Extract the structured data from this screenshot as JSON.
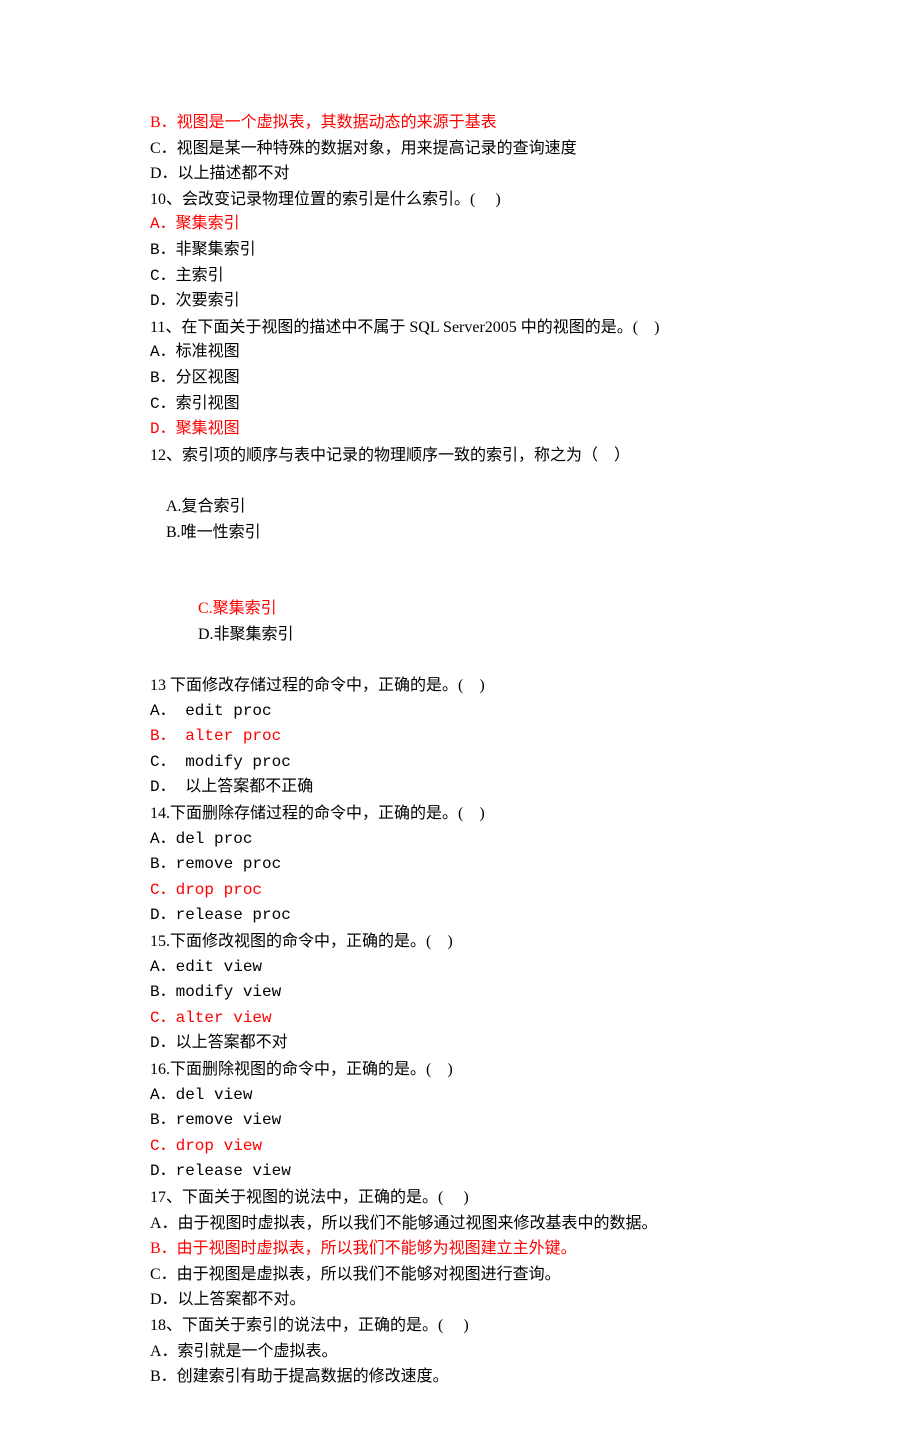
{
  "lines": {
    "l01": "B．视图是一个虚拟表，其数据动态的来源于基表",
    "l02": "C．视图是某一种特殊的数据对象，用来提高记录的查询速度",
    "l03": "D．以上描述都不对",
    "l04": "10、会改变记录物理位置的索引是什么索引。(     )",
    "l05": "A．聚集索引",
    "l06": "B．非聚集索引",
    "l07": "C．主索引",
    "l08": "D．次要索引",
    "l09": "11、在下面关于视图的描述中不属于 SQL Server2005 中的视图的是。(    )",
    "l10": "A．标准视图",
    "l11": "B．分区视图",
    "l12": "C．索引视图",
    "l13": "D．聚集视图",
    "l14": "12、索引项的顺序与表中记录的物理顺序一致的索引，称之为（    ）",
    "l15a": "A.复合索引",
    "l15b": "B.唯一性索引",
    "l16a": "C.聚集索引",
    "l16b": "D.非聚集索引",
    "l17": "13 下面修改存储过程的命令中，正确的是。(    )",
    "l18": "A． edit proc",
    "l19": "B． alter proc",
    "l20": "C． modify proc",
    "l21": "D． 以上答案都不正确",
    "l22": "14.下面删除存储过程的命令中，正确的是。(    )",
    "l23": "A．del proc",
    "l24": "B．remove proc",
    "l25": "C．drop proc",
    "l26": "D．release proc",
    "l27": "15.下面修改视图的命令中，正确的是。(    )",
    "l28": "A．edit view",
    "l29": "B．modify view",
    "l30": "C．alter view",
    "l31": "D．以上答案都不对",
    "l32": "16.下面删除视图的命令中，正确的是。(    )",
    "l33": "A．del view",
    "l34": "B．remove view",
    "l35": "C．drop view",
    "l36": "D．release view",
    "l37": "17、下面关于视图的说法中，正确的是。(     )",
    "l38": "A．由于视图时虚拟表，所以我们不能够通过视图来修改基表中的数据。",
    "l39": "B．由于视图时虚拟表，所以我们不能够为视图建立主外键。",
    "l40": "C．由于视图是虚拟表，所以我们不能够对视图进行查询。",
    "l41": "D．以上答案都不对。",
    "l42": "18、下面关于索引的说法中，正确的是。(     )",
    "l43": "A．索引就是一个虚拟表。",
    "l44": "B．创建索引有助于提高数据的修改速度。"
  }
}
